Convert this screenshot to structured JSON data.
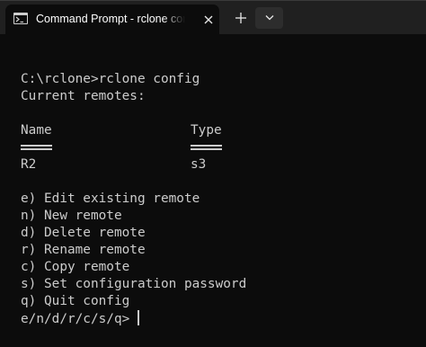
{
  "window": {
    "tab_title": "Command Prompt - rclone config"
  },
  "icons": {
    "tab": "terminal-icon",
    "close": "close-icon",
    "new_tab": "plus-icon",
    "dropdown": "chevron-down-icon"
  },
  "colors": {
    "background": "#0c0c0c",
    "titlebar": "#202020",
    "text": "#cccccc"
  },
  "console": {
    "command": "C:\\rclone>rclone config",
    "heading": "Current remotes:",
    "columns": {
      "name": "Name",
      "type": "Type"
    },
    "remotes": [
      {
        "name": "R2",
        "type": "s3"
      }
    ],
    "menu": [
      "e) Edit existing remote",
      "n) New remote",
      "d) Delete remote",
      "r) Rename remote",
      "c) Copy remote",
      "s) Set configuration password",
      "q) Quit config"
    ],
    "prompt": "e/n/d/r/c/s/q>"
  }
}
